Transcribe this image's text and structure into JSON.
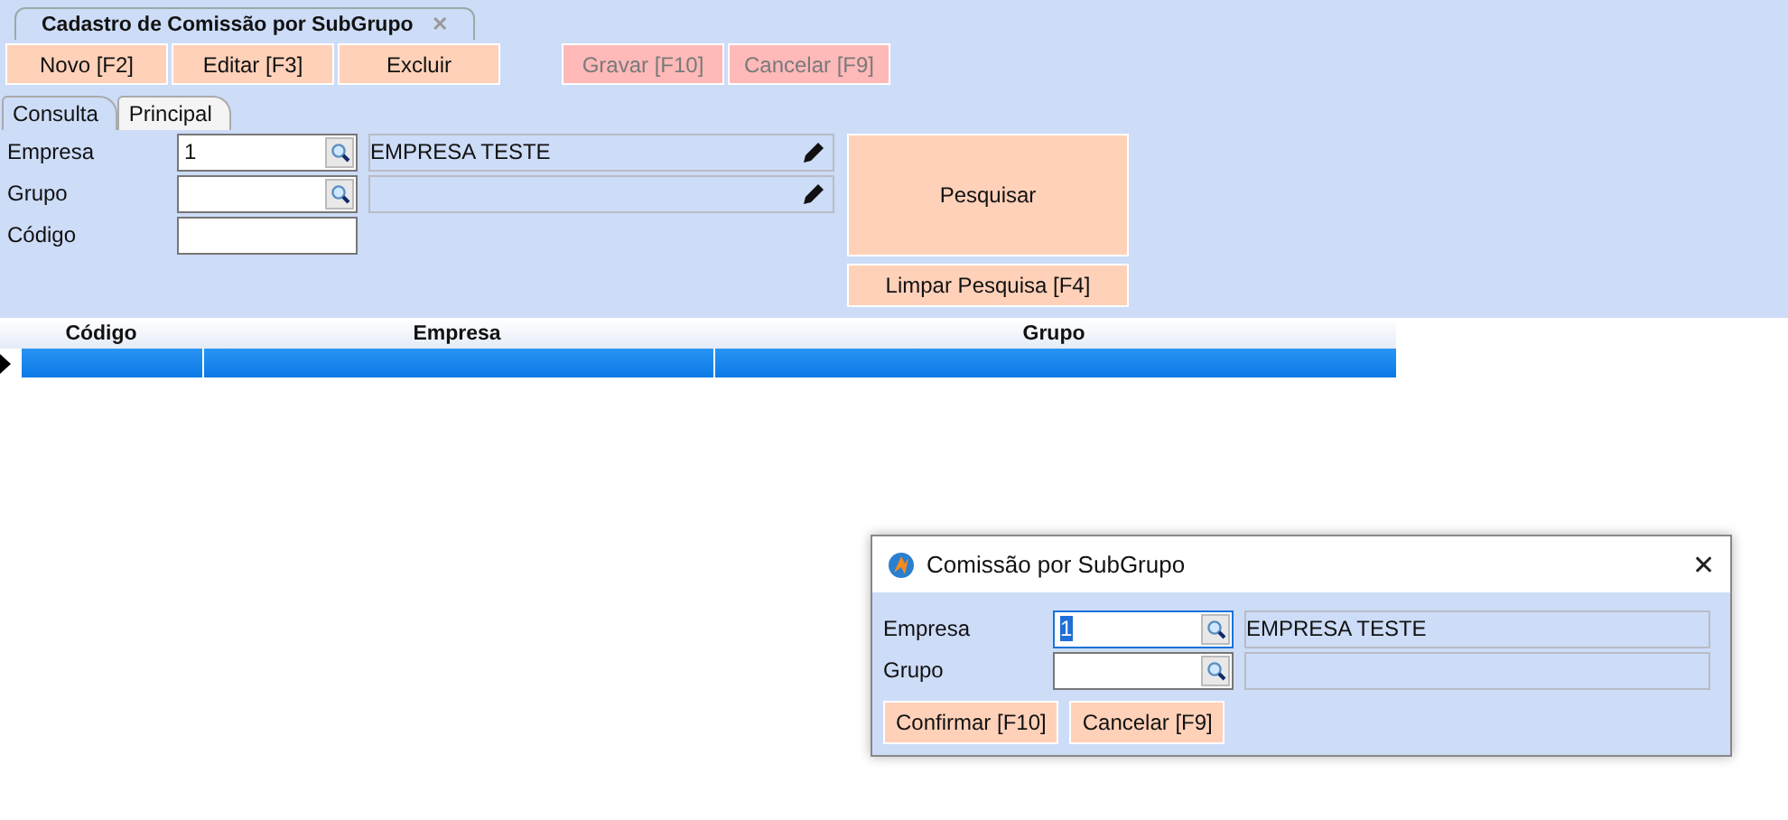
{
  "document_tab": {
    "title": "Cadastro de Comissão por SubGrupo",
    "close": "✕"
  },
  "toolbar": [
    {
      "label": "Novo [F2]",
      "disabled": false
    },
    {
      "label": "Editar [F3]",
      "disabled": false
    },
    {
      "label": "Excluir",
      "disabled": false
    },
    {
      "label": "Gravar [F10]",
      "disabled": true
    },
    {
      "label": "Cancelar [F9]",
      "disabled": true
    }
  ],
  "tabs": [
    {
      "label": "Consulta",
      "selected": true
    },
    {
      "label": "Principal",
      "selected": false
    }
  ],
  "filters": [
    {
      "kind": "lookup",
      "label": "Empresa",
      "value": "1",
      "description": "EMPRESA TESTE"
    },
    {
      "kind": "lookup",
      "label": "Grupo"
    },
    {
      "kind": "plain",
      "label": "Código"
    }
  ],
  "search_button": "Pesquisar",
  "clear_button": "Limpar Pesquisa [F4]",
  "grid": {
    "columns": [
      "Código",
      "Empresa",
      "Grupo"
    ],
    "rows": [
      {
        "cells": [
          "",
          "",
          ""
        ],
        "selected": true
      }
    ]
  },
  "dialog": {
    "title": "Comissão por SubGrupo",
    "close": "✕",
    "fields": [
      {
        "label": "Empresa",
        "value": "1",
        "focused": true,
        "description": "EMPRESA TESTE"
      },
      {
        "label": "Grupo",
        "focused": false
      }
    ],
    "buttons": [
      "Confirmar [F10]",
      "Cancelar [F9]"
    ]
  }
}
